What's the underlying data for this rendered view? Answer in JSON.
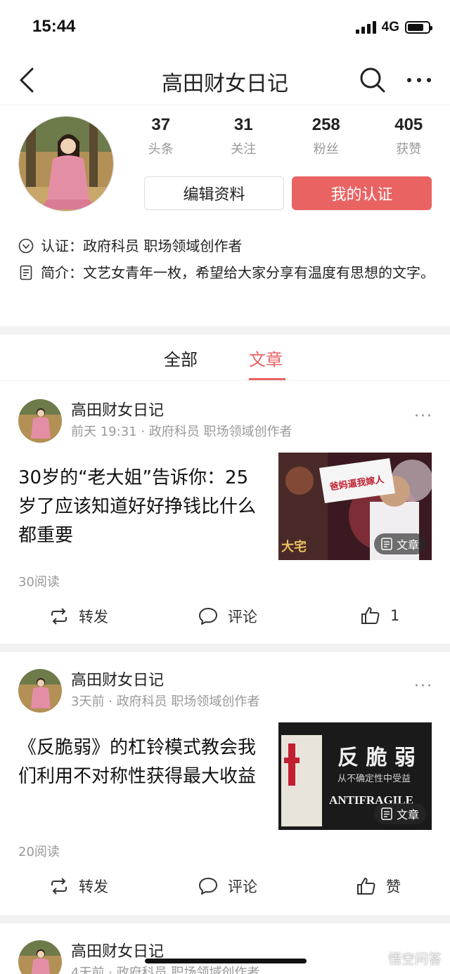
{
  "status": {
    "time": "15:44",
    "network": "4G",
    "battery_level": 0.8
  },
  "nav": {
    "title": "高田财女日记"
  },
  "profile": {
    "stats": [
      {
        "value": "37",
        "label": "头条"
      },
      {
        "value": "31",
        "label": "关注"
      },
      {
        "value": "258",
        "label": "粉丝"
      },
      {
        "value": "405",
        "label": "获赞"
      }
    ],
    "edit_label": "编辑资料",
    "verify_label": "我的认证",
    "verification": "认证：政府科员 职场领域创作者",
    "intro": "简介：文艺女青年一枚，希望给大家分享有温度有思想的文字。"
  },
  "tabs": {
    "all": "全部",
    "article": "文章"
  },
  "posts": [
    {
      "author": "高田财女日记",
      "meta": "前天 19:31 · 政府科员 职场领域创作者",
      "title": "30岁的“老大姐”告诉你：25岁了应该知道好好挣钱比什么都重要",
      "badge": "文章",
      "thumb_sign": "爸妈逼我嫁人",
      "thumb_corner": "大宅",
      "reads": "30阅读",
      "share": "转发",
      "comment": "评论",
      "like": "1"
    },
    {
      "author": "高田财女日记",
      "meta": "3天前 · 政府科员 职场领域创作者",
      "title": "《反脆弱》的杠铃模式教会我们利用不对称性获得最大收益",
      "badge": "文章",
      "thumb_big": "反 脆 弱",
      "thumb_sub": "从不确定性中受益",
      "thumb_en": "ANTIFRAGILE",
      "reads": "20阅读",
      "share": "转发",
      "comment": "评论",
      "like": "赞"
    },
    {
      "author": "高田财女日记",
      "meta": "4天前 · 政府科员 职场领域创作者"
    }
  ],
  "watermark": "悟空问答"
}
